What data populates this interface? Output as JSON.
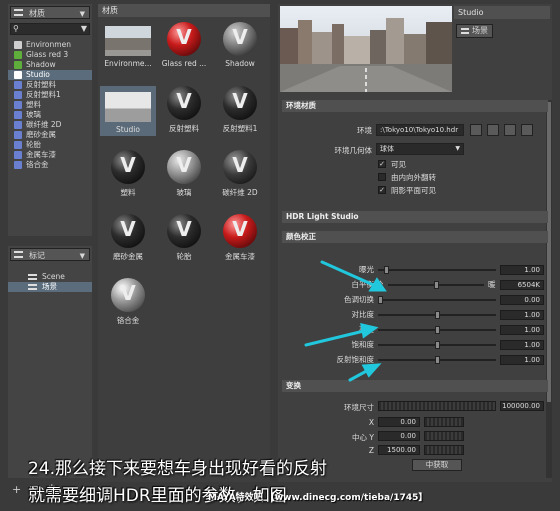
{
  "left_panel": {
    "dropdown_label": "材质",
    "tree": [
      {
        "label": "Environmen",
        "color": "#cfcfcf",
        "selected": false
      },
      {
        "label": "Glass red 3",
        "color": "#5fae3c",
        "selected": false
      },
      {
        "label": "Shadow",
        "color": "#5fae3c",
        "selected": false
      },
      {
        "label": "Studio",
        "color": "#ffffff",
        "selected": true
      },
      {
        "label": "反射塑料",
        "color": "#6b7fd0",
        "selected": false
      },
      {
        "label": "反射塑料1",
        "color": "#6b7fd0",
        "selected": false
      },
      {
        "label": "塑料",
        "color": "#6b7fd0",
        "selected": false
      },
      {
        "label": "玻璃",
        "color": "#6b7fd0",
        "selected": false
      },
      {
        "label": "碳纤维 2D",
        "color": "#6b7fd0",
        "selected": false
      },
      {
        "label": "磨砂金属",
        "color": "#6b7fd0",
        "selected": false
      },
      {
        "label": "轮胎",
        "color": "#6b7fd0",
        "selected": false
      },
      {
        "label": "金属车漆",
        "color": "#6b7fd0",
        "selected": false
      },
      {
        "label": "铬合金",
        "color": "#6b7fd0",
        "selected": false
      }
    ],
    "marker_dropdown": "标记",
    "scene_tree": [
      {
        "label": "Scene",
        "selected": false
      },
      {
        "label": "场景",
        "selected": true
      }
    ]
  },
  "material_grid": {
    "header": "材质",
    "items": [
      {
        "label": "Environme...",
        "kind": "env"
      },
      {
        "label": "Glass red ...",
        "kind": "red"
      },
      {
        "label": "Shadow",
        "kind": "grey"
      },
      {
        "label": "Studio",
        "kind": "studio"
      },
      {
        "label": "反射塑料",
        "kind": "black"
      },
      {
        "label": "反射塑料1",
        "kind": "black"
      },
      {
        "label": "塑料",
        "kind": "black"
      },
      {
        "label": "玻璃",
        "kind": "glass"
      },
      {
        "label": "碳纤维 2D",
        "kind": "carbon"
      },
      {
        "label": "磨砂金属",
        "kind": "black"
      },
      {
        "label": "轮胎",
        "kind": "black"
      },
      {
        "label": "金属车漆",
        "kind": "red"
      },
      {
        "label": "铬合金",
        "kind": "chrome"
      }
    ]
  },
  "right_panel": {
    "preview_name": "Studio",
    "scene_tag": "场景",
    "env_section": "环境材质",
    "env_label": "环境",
    "env_path": ":\\Tokyo10\\Tokyo10.hdr",
    "env_geo_label": "环境几何体",
    "env_geo_value": "球体",
    "checks": [
      {
        "label": "可见",
        "checked": true
      },
      {
        "label": "由内向外翻转",
        "checked": false
      },
      {
        "label": "阴影平面可见",
        "checked": true
      }
    ],
    "hdr_section": "HDR Light Studio",
    "color_section": "颜色校正",
    "color_rows": [
      {
        "label": "曝光",
        "value": "1.00",
        "pos": 0.05
      },
      {
        "label": "白平衡",
        "value": "6504K",
        "pos": 0.5,
        "left": "冷",
        "right": "暖"
      },
      {
        "label": "色调切换",
        "value": "0.00",
        "pos": 0.0
      },
      {
        "label": "对比度",
        "value": "1.00",
        "pos": 0.5
      },
      {
        "label": "亮度",
        "value": "1.00",
        "pos": 0.5
      },
      {
        "label": "饱和度",
        "value": "1.00",
        "pos": 0.5
      },
      {
        "label": "反射饱和度",
        "value": "1.00",
        "pos": 0.5
      }
    ],
    "transform_section": "变换",
    "env_size_label": "环境尺寸",
    "env_size_value": "100000.00",
    "x_label": "X",
    "x_value": "0.00",
    "center_y_label": "中心 Y",
    "center_y_value": "0.00",
    "z_label": "Z",
    "z_value": "1500.00",
    "get_center_label": "中获取"
  },
  "caption": {
    "line1": "24.那么接下来要想车身出现好看的反射",
    "line2": "就需要细调HDR里面的参数，如图"
  },
  "watermark": "MAYA特效吧 【www.dinecg.com/tieba/1745】"
}
